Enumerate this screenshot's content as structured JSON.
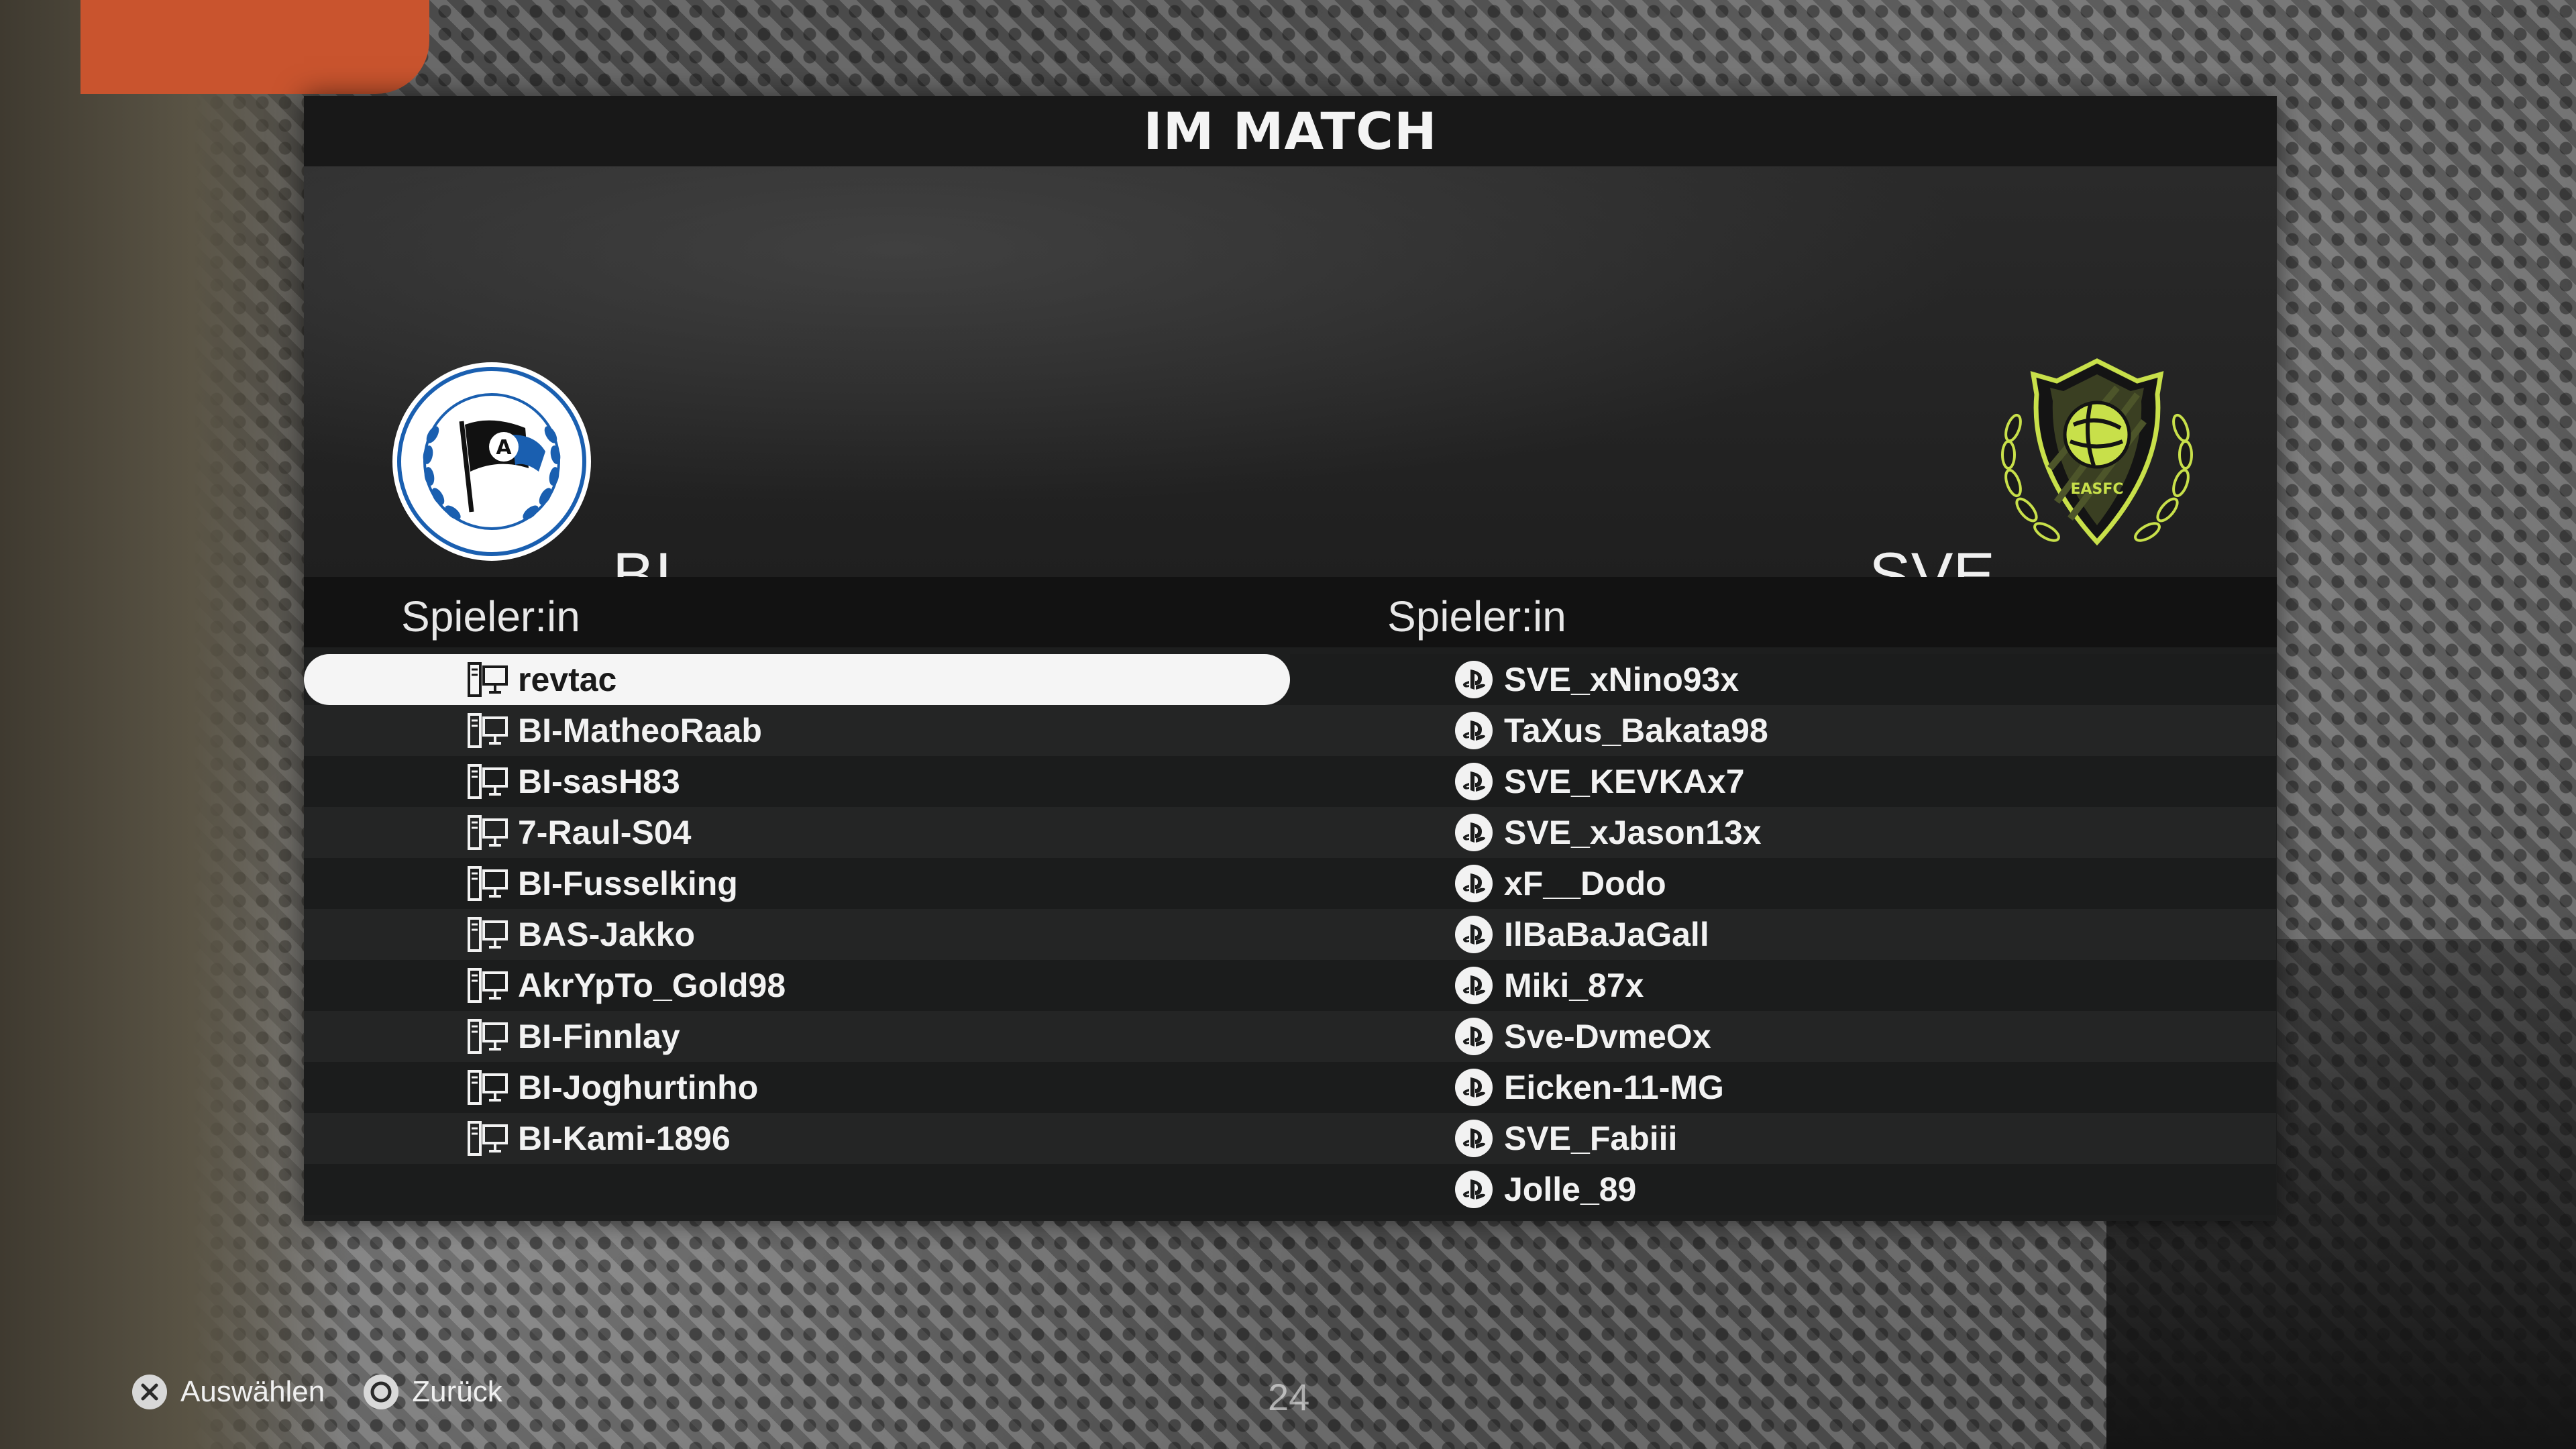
{
  "screen": {
    "title": "IM MATCH"
  },
  "home_team": {
    "abbr": "BI",
    "crest_icon": "arminia-bielefeld-crest-icon",
    "column_header": "Spieler:in",
    "platform_icon": "pc-icon",
    "players": [
      {
        "name": "revtac",
        "selected": true
      },
      {
        "name": "BI-MatheoRaab"
      },
      {
        "name": "BI-sasH83"
      },
      {
        "name": "7-Raul-S04"
      },
      {
        "name": "BI-Fusselking"
      },
      {
        "name": "BAS-Jakko"
      },
      {
        "name": "AkrYpTo_Gold98"
      },
      {
        "name": "BI-Finnlay"
      },
      {
        "name": "BI-Joghurtinho"
      },
      {
        "name": "BI-Kami-1896"
      }
    ]
  },
  "away_team": {
    "abbr": "SVE",
    "crest_icon": "easfc-crest-icon",
    "crest_text": "EASFC",
    "column_header": "Spieler:in",
    "platform_icon": "playstation-icon",
    "players": [
      {
        "name": "SVE_xNino93x"
      },
      {
        "name": "TaXus_Bakata98"
      },
      {
        "name": "SVE_KEVKAx7"
      },
      {
        "name": "SVE_xJason13x"
      },
      {
        "name": "xF__Dodo"
      },
      {
        "name": "IlBaBaJaGall"
      },
      {
        "name": "Miki_87x"
      },
      {
        "name": "Sve-DvmeOx"
      },
      {
        "name": "Eicken-11-MG"
      },
      {
        "name": "SVE_Fabiii"
      },
      {
        "name": "Jolle_89"
      }
    ]
  },
  "footer": {
    "select_label": "Auswählen",
    "select_icon": "cross-button-icon",
    "back_label": "Zurück",
    "back_icon": "circle-button-icon",
    "page_counter": "24"
  },
  "colors": {
    "panel": "#1d1e1e",
    "selected_row": "#f5f5f5",
    "away_crest_accent": "#c8e04a",
    "home_crest_blue": "#1a5fb0"
  }
}
